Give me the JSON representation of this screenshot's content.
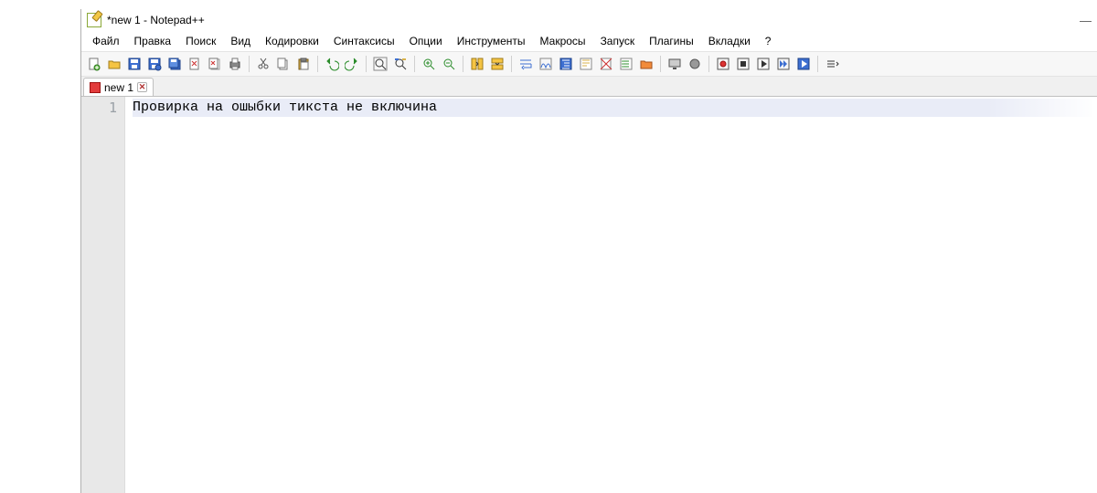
{
  "title": "*new 1 - Notepad++",
  "menu": {
    "items": [
      "Файл",
      "Правка",
      "Поиск",
      "Вид",
      "Кодировки",
      "Синтаксисы",
      "Опции",
      "Инструменты",
      "Макросы",
      "Запуск",
      "Плагины",
      "Вкладки",
      "?"
    ]
  },
  "toolbar": {
    "icons": [
      "new-file",
      "open-file",
      "save",
      "save-copy",
      "save-all",
      "close",
      "close-all",
      "print",
      "|",
      "cut",
      "copy",
      "paste",
      "|",
      "undo",
      "redo",
      "|",
      "find",
      "find-replace",
      "|",
      "zoom-in",
      "zoom-out",
      "|",
      "sync-v",
      "sync-h",
      "|",
      "wrap",
      "show-ws",
      "indent-guide",
      "lang-panel",
      "doc-map",
      "func-list",
      "folder",
      "|",
      "monitor",
      "clear",
      "|",
      "rec-macro",
      "stop-macro",
      "play-macro",
      "play-macro-multi",
      "save-macro",
      "|",
      "menu-overflow"
    ]
  },
  "tabs": [
    {
      "label": "new 1",
      "unsaved": true
    }
  ],
  "editor": {
    "lines": [
      {
        "n": "1",
        "text": "Провирка на ошыбки тикста не включина",
        "current": true
      }
    ]
  }
}
